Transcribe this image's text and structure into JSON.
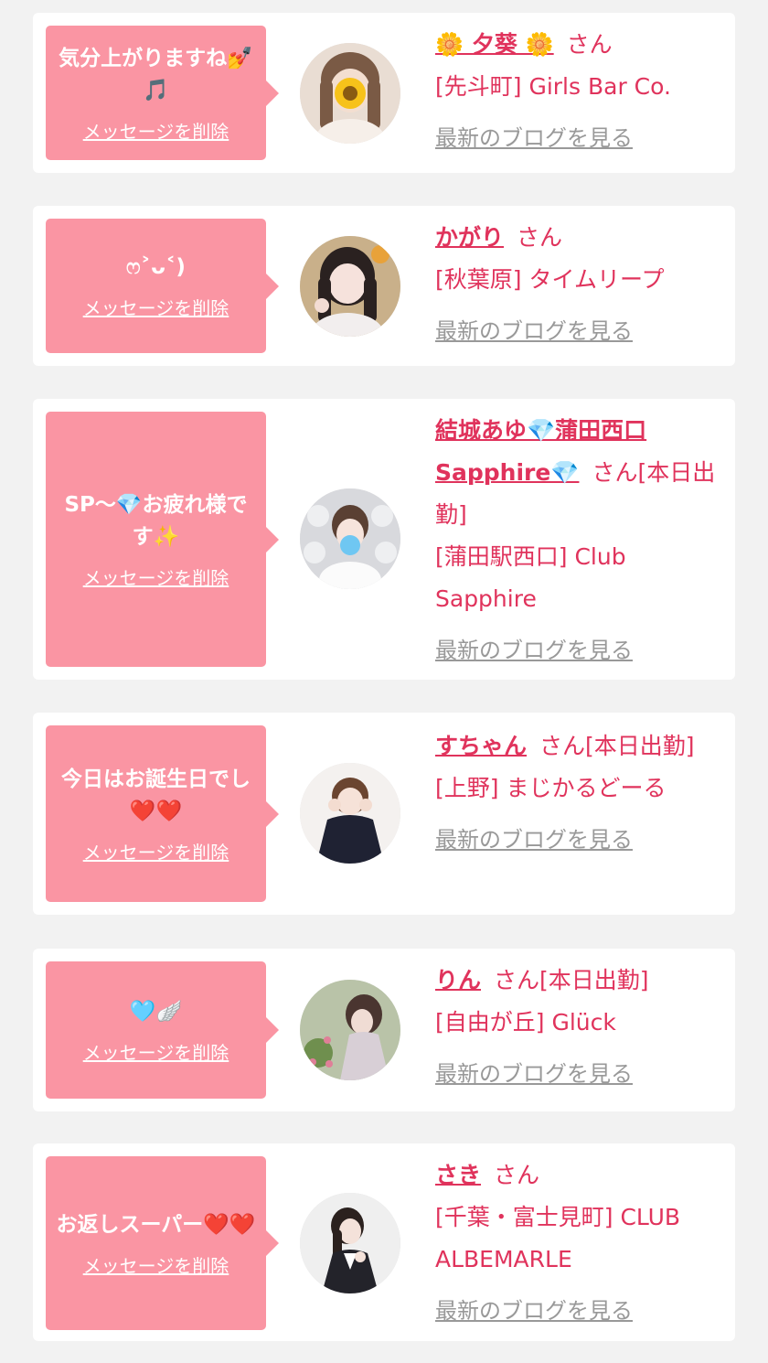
{
  "entries": [
    {
      "message": "気分上がりますね💅🎵",
      "delete_label": "メッセージを削除",
      "name": "🌼 夕葵 🌼",
      "honorific": "さん",
      "shop": "[先斗町] Girls Bar Co.",
      "blog_link": "最新のブログを見る"
    },
    {
      "message": "ෆ˃ᴗ˂)",
      "delete_label": "メッセージを削除",
      "name": "かがり",
      "honorific": "さん",
      "shop": "[秋葉原] タイムリープ",
      "blog_link": "最新のブログを見る"
    },
    {
      "message": "SP〜💎お疲れ様です✨",
      "delete_label": "メッセージを削除",
      "name": "結城あゆ💎蒲田西口Sapphire💎",
      "honorific": "さん[本日出勤]",
      "shop": "[蒲田駅西口] Club Sapphire",
      "blog_link": "最新のブログを見る"
    },
    {
      "message": "今日はお誕生日でし❤️❤️",
      "delete_label": "メッセージを削除",
      "name": "すちゃん",
      "honorific": "さん[本日出勤]",
      "shop": "[上野] まじかるどーる",
      "blog_link": "最新のブログを見る"
    },
    {
      "message": "🩵🪽",
      "delete_label": "メッセージを削除",
      "name": "りん",
      "honorific": "さん[本日出勤]",
      "shop": "[自由が丘] Glück",
      "blog_link": "最新のブログを見る"
    },
    {
      "message": "お返しスーパー❤️❤️",
      "delete_label": "メッセージを削除",
      "name": "さき",
      "honorific": "さん",
      "shop": "[千葉・富士見町] CLUB ALBEMARLE",
      "blog_link": "最新のブログを見る"
    }
  ],
  "colors": {
    "page_background": "#f2f2f2",
    "card_background": "#ffffff",
    "bubble": "#fa95a3",
    "accent_text": "#e0335c",
    "muted_link": "#999999"
  }
}
